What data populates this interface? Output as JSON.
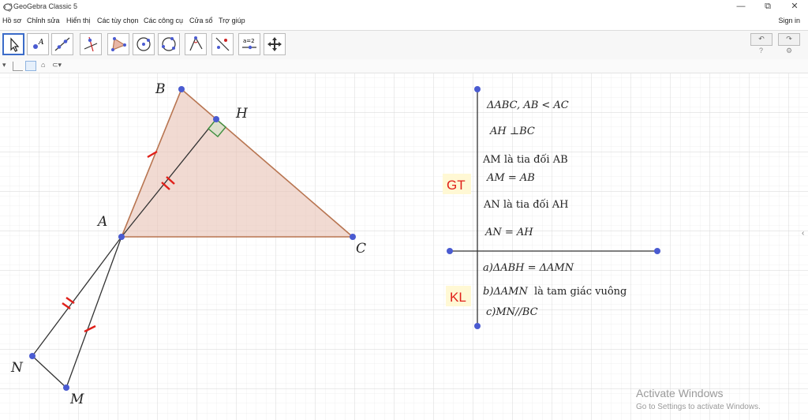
{
  "window": {
    "title": "GeoGebra Classic 5",
    "controls": [
      "—",
      "⧉",
      "✕"
    ]
  },
  "menu": {
    "items": [
      "Hồ sơ",
      "Chỉnh sửa",
      "Hiển thị",
      "Các tùy chọn",
      "Các công cụ",
      "Cửa sổ",
      "Trợ giúp"
    ],
    "sign_in": "Sign in"
  },
  "toolbar": {
    "tools": [
      "move-tool",
      "point-tool",
      "line-tool",
      "perpendicular-line-tool",
      "polygon-tool",
      "circle-center-point-tool",
      "circle-three-points-tool",
      "angle-tool",
      "reflect-tool",
      "slider-tool",
      "move-graphics-tool"
    ],
    "slider_label": "a=2",
    "undo": "↶",
    "redo": "↷",
    "help": "?",
    "settings": "⚙"
  },
  "geometry": {
    "points": {
      "B": "B",
      "H": "H",
      "A": "A",
      "C": "C",
      "N": "N",
      "M": "M"
    },
    "colors": {
      "triangle_fill": "#e8c2b4",
      "triangle_edge": "#b87551",
      "point": "#4a5bd1",
      "tick": "#e0201a",
      "right_angle": "#3f8f3f"
    }
  },
  "notes": {
    "gt_label": "GT",
    "kl_label": "KL",
    "gt": [
      "ΔABC, AB < AC",
      "AH ⊥BC",
      "AM là tia đối AB",
      "AM = AB",
      "AN là tia đối AH",
      "AN = AH"
    ],
    "kl": [
      "a)ΔABH = ΔAMN",
      "b)ΔAMN",
      "là tam giác vuông",
      "c)MN//BC"
    ]
  },
  "watermark": {
    "title": "Activate Windows",
    "subtitle": "Go to Settings to activate Windows."
  }
}
